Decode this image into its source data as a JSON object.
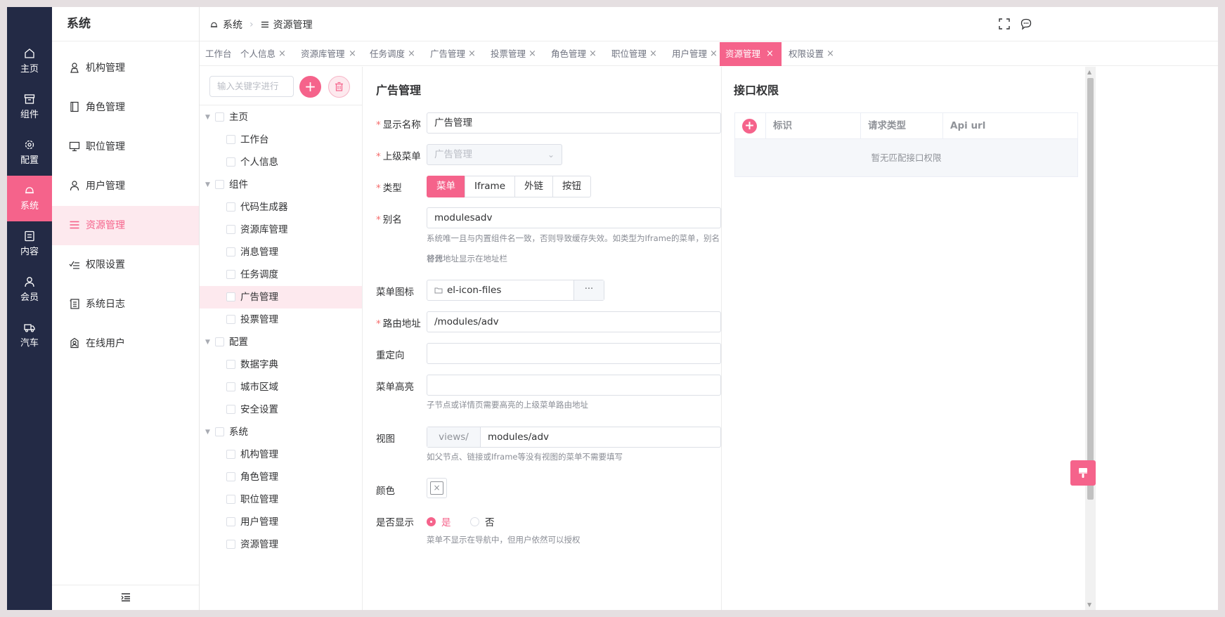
{
  "rail": {
    "items": [
      {
        "label": "主页",
        "icon": "home-icon"
      },
      {
        "label": "组件",
        "icon": "box-icon"
      },
      {
        "label": "配置",
        "icon": "gear-icon"
      },
      {
        "label": "系统",
        "icon": "bell-icon"
      },
      {
        "label": "内容",
        "icon": "document-icon"
      },
      {
        "label": "会员",
        "icon": "user-icon"
      },
      {
        "label": "汽车",
        "icon": "truck-icon"
      }
    ],
    "active_index": 3
  },
  "sidebar": {
    "title": "系统",
    "items": [
      {
        "label": "机构管理",
        "icon": "org-icon"
      },
      {
        "label": "角色管理",
        "icon": "notebook-icon"
      },
      {
        "label": "职位管理",
        "icon": "monitor-icon"
      },
      {
        "label": "用户管理",
        "icon": "user-icon"
      },
      {
        "label": "资源管理",
        "icon": "list-icon"
      },
      {
        "label": "权限设置",
        "icon": "check-list-icon"
      },
      {
        "label": "系统日志",
        "icon": "log-icon"
      },
      {
        "label": "在线用户",
        "icon": "online-user-icon"
      }
    ],
    "active_index": 4
  },
  "breadcrumb": {
    "items": [
      "系统",
      "资源管理"
    ]
  },
  "tabs": [
    {
      "label": "工作台",
      "closable": false
    },
    {
      "label": "个人信息",
      "closable": true
    },
    {
      "label": "资源库管理",
      "closable": true
    },
    {
      "label": "任务调度",
      "closable": true
    },
    {
      "label": "广告管理",
      "closable": true
    },
    {
      "label": "投票管理",
      "closable": true
    },
    {
      "label": "角色管理",
      "closable": true
    },
    {
      "label": "职位管理",
      "closable": true
    },
    {
      "label": "用户管理",
      "closable": true
    },
    {
      "label": "资源管理",
      "closable": true,
      "active": true
    },
    {
      "label": "权限设置",
      "closable": true
    }
  ],
  "tree": {
    "search_placeholder": "输入关键字进行",
    "nodes": [
      {
        "label": "主页",
        "level": 0
      },
      {
        "label": "工作台",
        "level": 1
      },
      {
        "label": "个人信息",
        "level": 1
      },
      {
        "label": "组件",
        "level": 0
      },
      {
        "label": "代码生成器",
        "level": 1
      },
      {
        "label": "资源库管理",
        "level": 1
      },
      {
        "label": "消息管理",
        "level": 1
      },
      {
        "label": "任务调度",
        "level": 1
      },
      {
        "label": "广告管理",
        "level": 1,
        "active": true
      },
      {
        "label": "投票管理",
        "level": 1
      },
      {
        "label": "配置",
        "level": 0
      },
      {
        "label": "数据字典",
        "level": 1
      },
      {
        "label": "城市区域",
        "level": 1
      },
      {
        "label": "安全设置",
        "level": 1
      },
      {
        "label": "系统",
        "level": 0
      },
      {
        "label": "机构管理",
        "level": 1
      },
      {
        "label": "角色管理",
        "level": 1
      },
      {
        "label": "职位管理",
        "level": 1
      },
      {
        "label": "用户管理",
        "level": 1
      },
      {
        "label": "资源管理",
        "level": 1
      }
    ]
  },
  "form": {
    "title": "广告管理",
    "display_name": {
      "label": "显示名称",
      "value": "广告管理"
    },
    "parent_menu": {
      "label": "上级菜单",
      "value": "广告管理"
    },
    "type": {
      "label": "类型",
      "options": [
        "菜单",
        "Iframe",
        "外链",
        "按钮"
      ],
      "selected": "菜单"
    },
    "alias": {
      "label": "别名",
      "value": "modulesadv",
      "help_line1": "系统唯一且与内置组件名一致，否则导致缓存失效。如类型为Iframe的菜单，别名将代",
      "help_line2": "替源地址显示在地址栏"
    },
    "menu_icon": {
      "label": "菜单图标",
      "value": "el-icon-files",
      "more": "···"
    },
    "route": {
      "label": "路由地址",
      "value": "/modules/adv"
    },
    "redirect": {
      "label": "重定向",
      "value": ""
    },
    "highlight": {
      "label": "菜单高亮",
      "value": "",
      "help": "子节点或详情页需要高亮的上级菜单路由地址"
    },
    "view": {
      "label": "视图",
      "prefix": "views/",
      "value": "modules/adv",
      "help": "如父节点、链接或Iframe等没有视图的菜单不需要填写"
    },
    "color": {
      "label": "颜色"
    },
    "visible": {
      "label": "是否显示",
      "yes": "是",
      "no": "否",
      "selected": "是",
      "help": "菜单不显示在导航中，但用户依然可以授权"
    }
  },
  "api": {
    "title": "接口权限",
    "columns": [
      "标识",
      "请求类型",
      "Api url"
    ],
    "empty_text": "暂无匹配接口权限"
  },
  "colors": {
    "accent": "#f5638b",
    "rail_bg": "#232a45",
    "active_bg": "#fde9ee"
  }
}
